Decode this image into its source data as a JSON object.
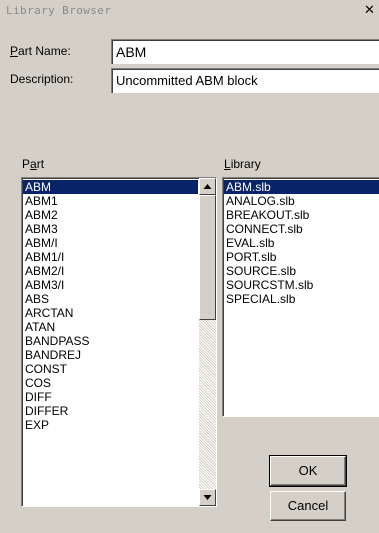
{
  "window": {
    "title": "Library Browser"
  },
  "titlebar": {
    "close_glyph": "✕",
    "close_icon": "close-icon"
  },
  "form": {
    "part_name_label": "Part Name:",
    "part_name_value": "ABM",
    "description_label": "Description:",
    "description_value": "Uncommitted ABM block"
  },
  "part_list": {
    "label": "Part",
    "selected_index": 0,
    "items": [
      "ABM",
      "ABM1",
      "ABM2",
      "ABM3",
      "ABM/I",
      "ABM1/I",
      "ABM2/I",
      "ABM3/I",
      "ABS",
      "ARCTAN",
      "ATAN",
      "BANDPASS",
      "BANDREJ",
      "CONST",
      "COS",
      "DIFF",
      "DIFFER",
      "EXP"
    ]
  },
  "library_list": {
    "label": "Library",
    "selected_index": 0,
    "items": [
      "ABM.slb",
      "ANALOG.slb",
      "BREAKOUT.slb",
      "CONNECT.slb",
      "EVAL.slb",
      "PORT.slb",
      "SOURCE.slb",
      "SOURCSTM.slb",
      "SPECIAL.slb"
    ]
  },
  "buttons": {
    "ok_label": "OK",
    "cancel_label": "Cancel"
  },
  "colors": {
    "face": "#d4d0c8",
    "selection": "#0a246a",
    "selection_text": "#ffffff"
  }
}
